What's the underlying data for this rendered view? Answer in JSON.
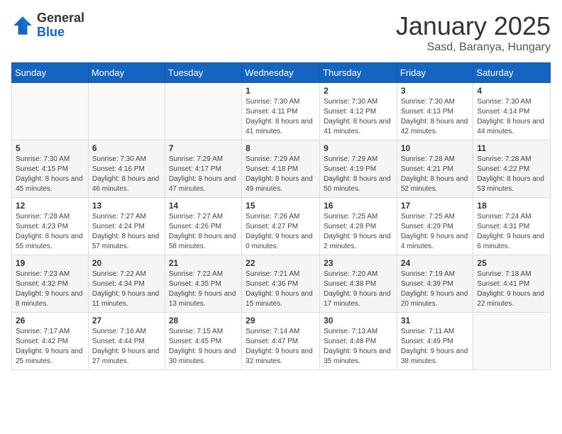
{
  "header": {
    "logo_general": "General",
    "logo_blue": "Blue",
    "month": "January 2025",
    "location": "Sasd, Baranya, Hungary"
  },
  "days_of_week": [
    "Sunday",
    "Monday",
    "Tuesday",
    "Wednesday",
    "Thursday",
    "Friday",
    "Saturday"
  ],
  "weeks": [
    [
      {
        "day": "",
        "info": ""
      },
      {
        "day": "",
        "info": ""
      },
      {
        "day": "",
        "info": ""
      },
      {
        "day": "1",
        "info": "Sunrise: 7:30 AM\nSunset: 4:11 PM\nDaylight: 8 hours and 41 minutes."
      },
      {
        "day": "2",
        "info": "Sunrise: 7:30 AM\nSunset: 4:12 PM\nDaylight: 8 hours and 41 minutes."
      },
      {
        "day": "3",
        "info": "Sunrise: 7:30 AM\nSunset: 4:13 PM\nDaylight: 8 hours and 42 minutes."
      },
      {
        "day": "4",
        "info": "Sunrise: 7:30 AM\nSunset: 4:14 PM\nDaylight: 8 hours and 44 minutes."
      }
    ],
    [
      {
        "day": "5",
        "info": "Sunrise: 7:30 AM\nSunset: 4:15 PM\nDaylight: 8 hours and 45 minutes."
      },
      {
        "day": "6",
        "info": "Sunrise: 7:30 AM\nSunset: 4:16 PM\nDaylight: 8 hours and 46 minutes."
      },
      {
        "day": "7",
        "info": "Sunrise: 7:29 AM\nSunset: 4:17 PM\nDaylight: 8 hours and 47 minutes."
      },
      {
        "day": "8",
        "info": "Sunrise: 7:29 AM\nSunset: 4:18 PM\nDaylight: 8 hours and 49 minutes."
      },
      {
        "day": "9",
        "info": "Sunrise: 7:29 AM\nSunset: 4:19 PM\nDaylight: 8 hours and 50 minutes."
      },
      {
        "day": "10",
        "info": "Sunrise: 7:28 AM\nSunset: 4:21 PM\nDaylight: 8 hours and 52 minutes."
      },
      {
        "day": "11",
        "info": "Sunrise: 7:28 AM\nSunset: 4:22 PM\nDaylight: 8 hours and 53 minutes."
      }
    ],
    [
      {
        "day": "12",
        "info": "Sunrise: 7:28 AM\nSunset: 4:23 PM\nDaylight: 8 hours and 55 minutes."
      },
      {
        "day": "13",
        "info": "Sunrise: 7:27 AM\nSunset: 4:24 PM\nDaylight: 8 hours and 57 minutes."
      },
      {
        "day": "14",
        "info": "Sunrise: 7:27 AM\nSunset: 4:26 PM\nDaylight: 8 hours and 58 minutes."
      },
      {
        "day": "15",
        "info": "Sunrise: 7:26 AM\nSunset: 4:27 PM\nDaylight: 9 hours and 0 minutes."
      },
      {
        "day": "16",
        "info": "Sunrise: 7:25 AM\nSunset: 4:28 PM\nDaylight: 9 hours and 2 minutes."
      },
      {
        "day": "17",
        "info": "Sunrise: 7:25 AM\nSunset: 4:29 PM\nDaylight: 9 hours and 4 minutes."
      },
      {
        "day": "18",
        "info": "Sunrise: 7:24 AM\nSunset: 4:31 PM\nDaylight: 9 hours and 6 minutes."
      }
    ],
    [
      {
        "day": "19",
        "info": "Sunrise: 7:23 AM\nSunset: 4:32 PM\nDaylight: 9 hours and 8 minutes."
      },
      {
        "day": "20",
        "info": "Sunrise: 7:22 AM\nSunset: 4:34 PM\nDaylight: 9 hours and 11 minutes."
      },
      {
        "day": "21",
        "info": "Sunrise: 7:22 AM\nSunset: 4:35 PM\nDaylight: 9 hours and 13 minutes."
      },
      {
        "day": "22",
        "info": "Sunrise: 7:21 AM\nSunset: 4:36 PM\nDaylight: 9 hours and 15 minutes."
      },
      {
        "day": "23",
        "info": "Sunrise: 7:20 AM\nSunset: 4:38 PM\nDaylight: 9 hours and 17 minutes."
      },
      {
        "day": "24",
        "info": "Sunrise: 7:19 AM\nSunset: 4:39 PM\nDaylight: 9 hours and 20 minutes."
      },
      {
        "day": "25",
        "info": "Sunrise: 7:18 AM\nSunset: 4:41 PM\nDaylight: 9 hours and 22 minutes."
      }
    ],
    [
      {
        "day": "26",
        "info": "Sunrise: 7:17 AM\nSunset: 4:42 PM\nDaylight: 9 hours and 25 minutes."
      },
      {
        "day": "27",
        "info": "Sunrise: 7:16 AM\nSunset: 4:44 PM\nDaylight: 9 hours and 27 minutes."
      },
      {
        "day": "28",
        "info": "Sunrise: 7:15 AM\nSunset: 4:45 PM\nDaylight: 9 hours and 30 minutes."
      },
      {
        "day": "29",
        "info": "Sunrise: 7:14 AM\nSunset: 4:47 PM\nDaylight: 9 hours and 32 minutes."
      },
      {
        "day": "30",
        "info": "Sunrise: 7:13 AM\nSunset: 4:48 PM\nDaylight: 9 hours and 35 minutes."
      },
      {
        "day": "31",
        "info": "Sunrise: 7:11 AM\nSunset: 4:49 PM\nDaylight: 9 hours and 38 minutes."
      },
      {
        "day": "",
        "info": ""
      }
    ]
  ]
}
